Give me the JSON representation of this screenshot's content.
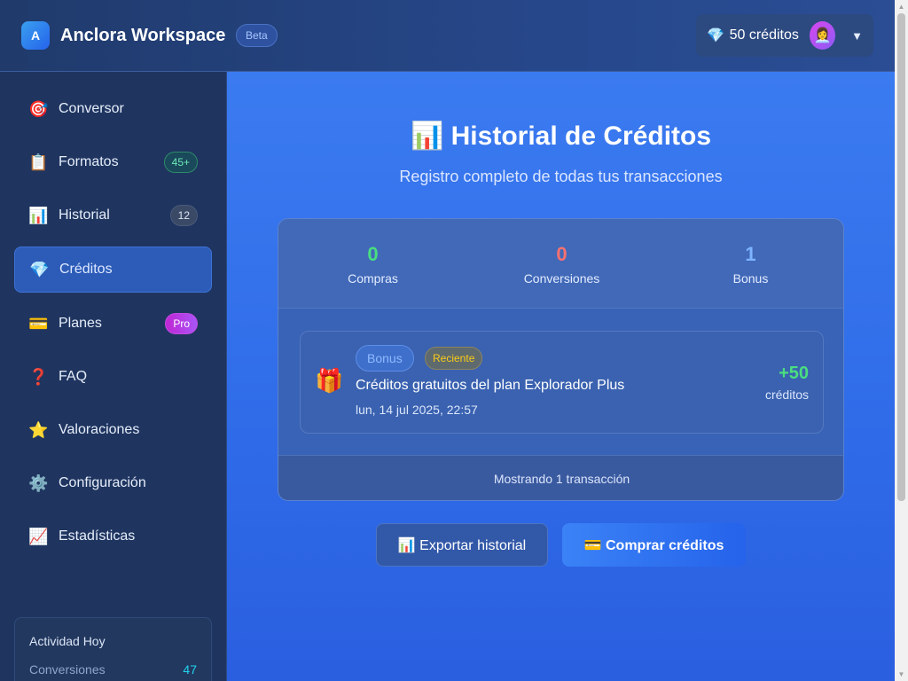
{
  "header": {
    "logo_letter": "A",
    "app_name": "Anclora Workspace",
    "beta_label": "Beta",
    "credits_icon": "💎",
    "credits_text": "50 créditos",
    "avatar_icon": "👩‍💼",
    "caret": "▼"
  },
  "sidebar": {
    "items": [
      {
        "icon": "🎯",
        "label": "Conversor",
        "badge": ""
      },
      {
        "icon": "📋",
        "label": "Formatos",
        "badge": "45+"
      },
      {
        "icon": "📊",
        "label": "Historial",
        "badge": "12"
      },
      {
        "icon": "💎",
        "label": "Créditos",
        "badge": ""
      },
      {
        "icon": "💳",
        "label": "Planes",
        "badge": "Pro"
      },
      {
        "icon": "❓",
        "label": "FAQ",
        "badge": ""
      },
      {
        "icon": "⭐",
        "label": "Valoraciones",
        "badge": ""
      },
      {
        "icon": "⚙️",
        "label": "Configuración",
        "badge": ""
      },
      {
        "icon": "📈",
        "label": "Estadísticas",
        "badge": ""
      }
    ],
    "activity": {
      "title": "Actividad Hoy",
      "rows": [
        {
          "label": "Conversiones",
          "value": "47"
        }
      ]
    }
  },
  "main": {
    "title": "📊 Historial de Créditos",
    "subtitle": "Registro completo de todas tus transacciones",
    "stats": [
      {
        "value": "0",
        "label": "Compras"
      },
      {
        "value": "0",
        "label": "Conversiones"
      },
      {
        "value": "1",
        "label": "Bonus"
      }
    ],
    "transaction": {
      "icon": "🎁",
      "type": "Bonus",
      "tag": "Reciente",
      "description": "Créditos gratuitos del plan Explorador Plus",
      "date": "lun, 14 jul 2025, 22:57",
      "amount": "+50",
      "unit": "créditos"
    },
    "footer_text": "Mostrando 1 transacción",
    "export_button": "📊 Exportar historial",
    "buy_button": "💳 Comprar créditos"
  },
  "colors": {
    "accent": "#2563eb",
    "positive": "#4ade80",
    "negative": "#f87171",
    "sidebar_bg": "#1f3560"
  }
}
